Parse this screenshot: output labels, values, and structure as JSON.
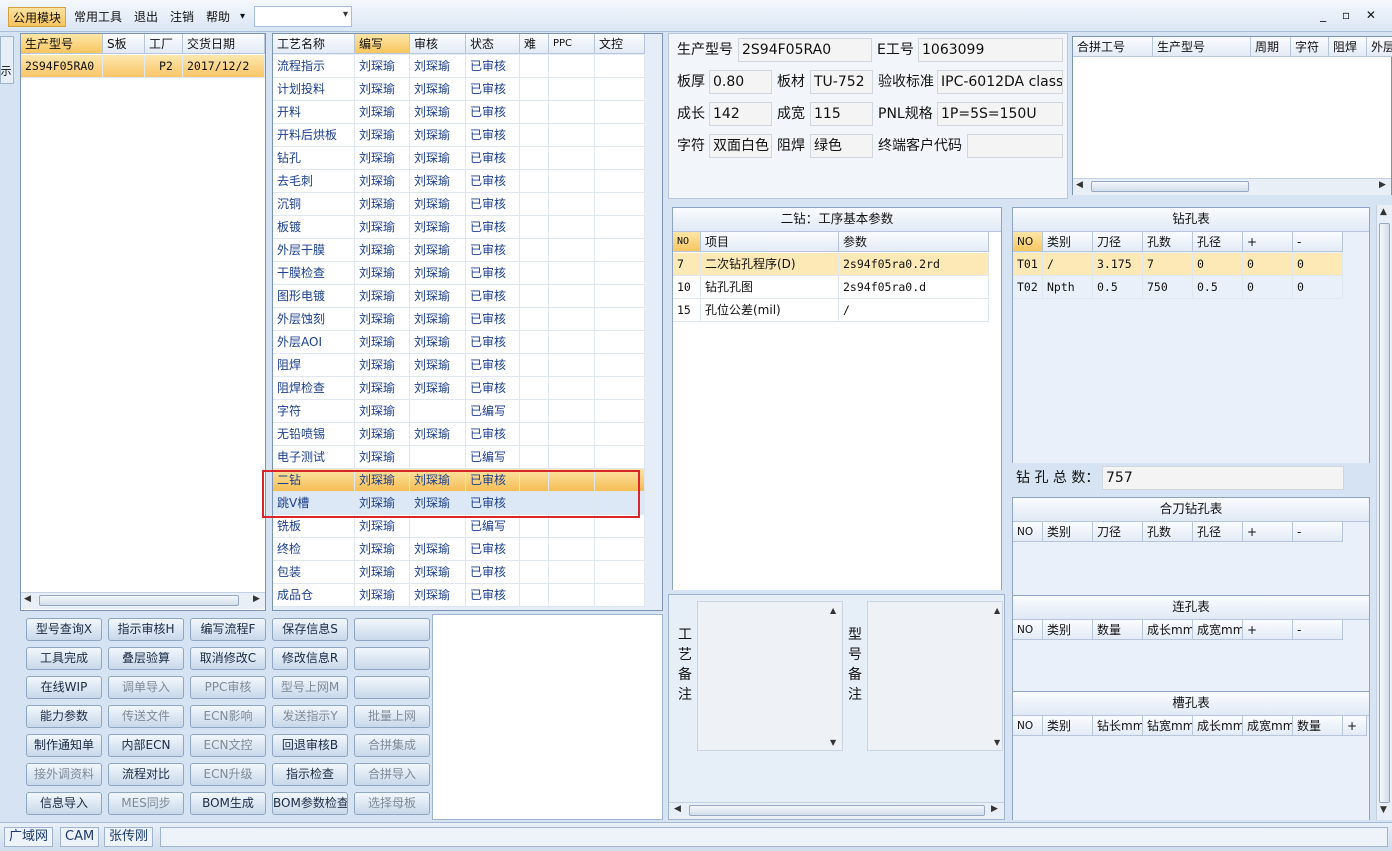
{
  "menu": {
    "items": [
      "公用模块",
      "常用工具",
      "退出",
      "注销",
      "帮助"
    ],
    "window_controls": "_ ▫ ✕"
  },
  "left_strip": "示",
  "model_grid": {
    "headers": [
      "生产型号",
      "S板",
      "工厂",
      "交货日期"
    ],
    "rows": [
      [
        "2S94F05RA0",
        "",
        "P2",
        "2017/12/2"
      ]
    ]
  },
  "process_grid": {
    "headers": [
      "工艺名称",
      "编写",
      "审核",
      "状态",
      "难",
      "PPC",
      "文控"
    ],
    "rows": [
      [
        "流程指示",
        "刘琛瑜",
        "刘琛瑜",
        "已审核"
      ],
      [
        "计划投料",
        "刘琛瑜",
        "刘琛瑜",
        "已审核"
      ],
      [
        "开料",
        "刘琛瑜",
        "刘琛瑜",
        "已审核"
      ],
      [
        "开料后烘板",
        "刘琛瑜",
        "刘琛瑜",
        "已审核"
      ],
      [
        "钻孔",
        "刘琛瑜",
        "刘琛瑜",
        "已审核"
      ],
      [
        "去毛刺",
        "刘琛瑜",
        "刘琛瑜",
        "已审核"
      ],
      [
        "沉铜",
        "刘琛瑜",
        "刘琛瑜",
        "已审核"
      ],
      [
        "板镀",
        "刘琛瑜",
        "刘琛瑜",
        "已审核"
      ],
      [
        "外层干膜",
        "刘琛瑜",
        "刘琛瑜",
        "已审核"
      ],
      [
        "干膜检查",
        "刘琛瑜",
        "刘琛瑜",
        "已审核"
      ],
      [
        "图形电镀",
        "刘琛瑜",
        "刘琛瑜",
        "已审核"
      ],
      [
        "外层蚀刻",
        "刘琛瑜",
        "刘琛瑜",
        "已审核"
      ],
      [
        "外层AOI",
        "刘琛瑜",
        "刘琛瑜",
        "已审核"
      ],
      [
        "阻焊",
        "刘琛瑜",
        "刘琛瑜",
        "已审核"
      ],
      [
        "阻焊检查",
        "刘琛瑜",
        "刘琛瑜",
        "已审核"
      ],
      [
        "字符",
        "刘琛瑜",
        "",
        "已编写"
      ],
      [
        "无铅喷锡",
        "刘琛瑜",
        "刘琛瑜",
        "已审核"
      ],
      [
        "电子测试",
        "刘琛瑜",
        "",
        "已编写"
      ],
      [
        "二钻",
        "刘琛瑜",
        "刘琛瑜",
        "已审核"
      ],
      [
        "跳V槽",
        "刘琛瑜",
        "刘琛瑜",
        "已审核"
      ],
      [
        "铣板",
        "刘琛瑜",
        "",
        "已编写"
      ],
      [
        "终检",
        "刘琛瑜",
        "刘琛瑜",
        "已审核"
      ],
      [
        "包装",
        "刘琛瑜",
        "刘琛瑜",
        "已审核"
      ],
      [
        "成品仓",
        "刘琛瑜",
        "刘琛瑜",
        "已审核"
      ]
    ]
  },
  "buttons": [
    [
      "型号查询X",
      "指示审核H",
      "编写流程F",
      "保存信息S",
      ""
    ],
    [
      "工具完成",
      "叠层验算",
      "取消修改C",
      "修改信息R",
      ""
    ],
    [
      "在线WIP",
      "调单导入",
      "PPC审核",
      "型号上网M",
      ""
    ],
    [
      "能力参数",
      "传送文件",
      "ECN影响",
      "发送指示Y",
      "批量上网"
    ],
    [
      "制作通知单",
      "内部ECN",
      "ECN文控",
      "回退审核B",
      "合拼集成"
    ],
    [
      "接外调资料",
      "流程对比",
      "ECN升级",
      "指示检查",
      "合拼导入"
    ],
    [
      "信息导入",
      "MES同步",
      "BOM生成",
      "BOM参数检查",
      "选择母板"
    ]
  ],
  "disabled_buttons": [
    "调单导入",
    "PPC审核",
    "型号上网M",
    "传送文件",
    "ECN影响",
    "发送指示Y",
    "批量上网",
    "ECN文控",
    "合拼集成",
    "接外调资料",
    "ECN升级",
    "合拼导入",
    "MES同步",
    "选择母板"
  ],
  "info": {
    "model_label": "生产型号",
    "model_value": "2S94F05RA0",
    "eno_label": "E工号",
    "eno_value": "1063099",
    "thick_label": "板厚",
    "thick_value": "0.80",
    "material_label": "板材",
    "material_value": "TU-752",
    "std_label": "验收标准",
    "std_value": "IPC-6012DA class3",
    "len_label": "成长",
    "len_value": "142",
    "wid_label": "成宽",
    "wid_value": "115",
    "pnl_label": "PNL规格",
    "pnl_value": "1P=5S=150U",
    "char_label": "字符",
    "char_value": "双面白色",
    "mask_label": "阻焊",
    "mask_value": "绿色",
    "cust_label": "终端客户代码",
    "cust_value": ""
  },
  "merge_grid": {
    "headers": [
      "合拼工号",
      "生产型号",
      "周期",
      "字符",
      "阻焊",
      "外层"
    ]
  },
  "param_panel": {
    "title": "二钻：工序基本参数",
    "headers": [
      "NO",
      "项目",
      "参数"
    ],
    "rows": [
      [
        "7",
        "二次钻孔程序(D)",
        "2s94f05ra0.2rd"
      ],
      [
        "10",
        "钻孔孔图",
        "2s94f05ra0.d"
      ],
      [
        "15",
        "孔位公差(mil)",
        "/"
      ]
    ]
  },
  "drill_table": {
    "title": "钻孔表",
    "headers": [
      "NO",
      "类别",
      "刀径",
      "孔数",
      "孔径",
      "+",
      "-"
    ],
    "rows": [
      [
        "T01",
        "/",
        "3.175",
        "7",
        "0",
        "0",
        "0"
      ],
      [
        "T02",
        "Npth",
        "0.5",
        "750",
        "0.5",
        "0",
        "0"
      ]
    ],
    "total_label": "钻 孔 总 数：",
    "total_value": "757"
  },
  "combo_drill": {
    "title": "合刀钻孔表",
    "headers": [
      "NO",
      "类别",
      "刀径",
      "孔数",
      "孔径",
      "+",
      "-"
    ]
  },
  "link_table": {
    "title": "连孔表",
    "headers": [
      "NO",
      "类别",
      "数量",
      "成长mm",
      "成宽mm",
      "+",
      "-"
    ]
  },
  "slot_table": {
    "title": "槽孔表",
    "headers": [
      "NO",
      "类别",
      "钻长mm",
      "钻宽mm",
      "成长mm",
      "成宽mm",
      "数量",
      "+"
    ]
  },
  "remarks": {
    "process_label": [
      "工",
      "艺",
      "备",
      "注"
    ],
    "model_label": [
      "型",
      "号",
      "备",
      "注"
    ]
  },
  "status": [
    "广域网",
    "CAM",
    "张传刚"
  ]
}
